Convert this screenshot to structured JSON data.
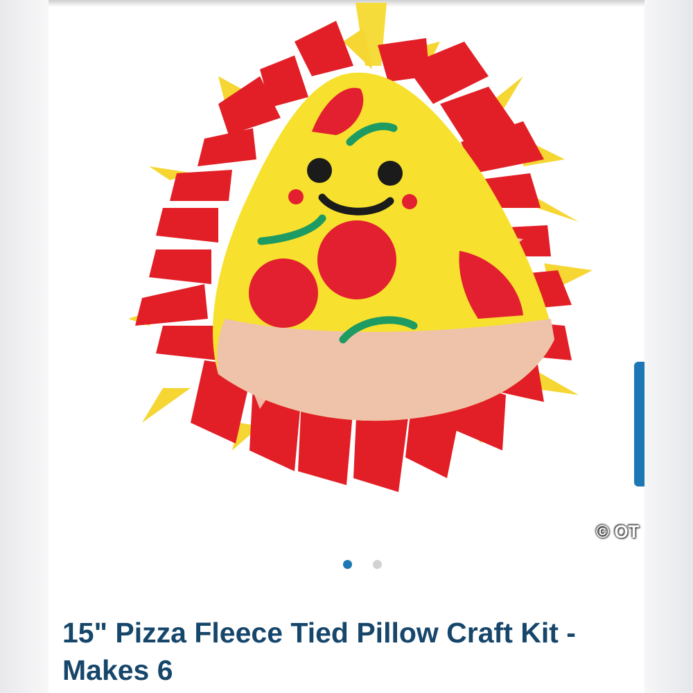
{
  "product": {
    "title": "15\" Pizza Fleece Tied Pillow Craft Kit - Makes 6",
    "image": {
      "icon": "pizza-pillow-image",
      "watermark_text": "© OT"
    }
  },
  "carousel": {
    "total_slides": 2,
    "active_index": 0
  },
  "colors": {
    "accent": "#1d77b5",
    "title": "#17466b",
    "dot_inactive": "#d2d2d2"
  }
}
